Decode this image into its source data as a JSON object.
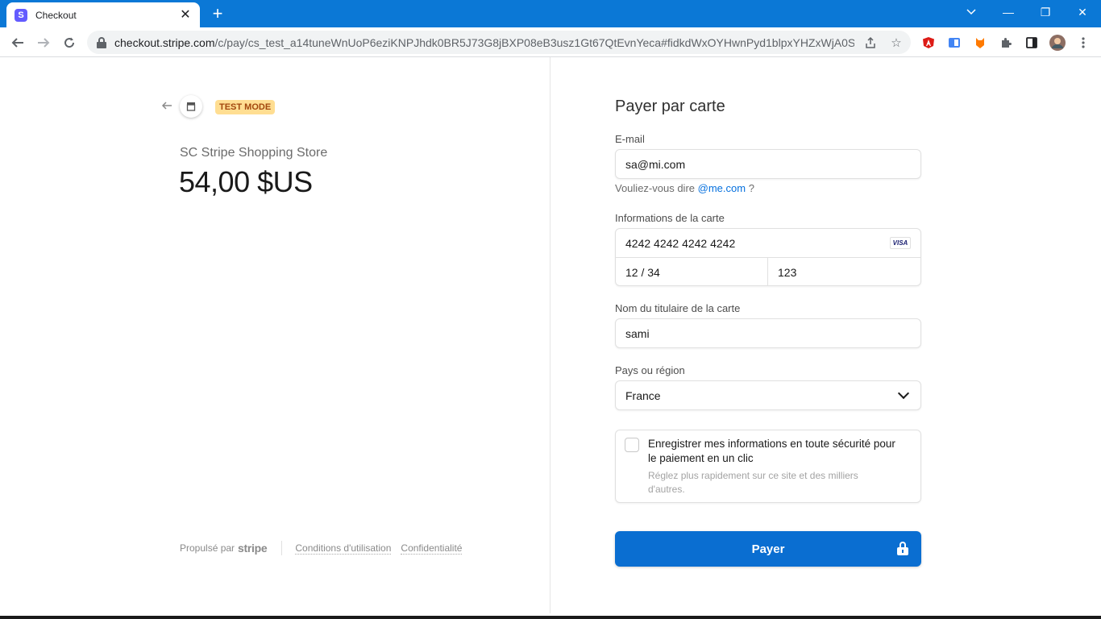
{
  "browser": {
    "tab_title": "Checkout",
    "tab_favicon": "S",
    "url_host": "checkout.stripe.com",
    "url_path": "/c/pay/cs_test_a14tuneWnUoP6eziKNPJhdk0BR5J73G8jBXP08eB3usz1Gt67QtEvnYeca#fidkdWxOYHwnPyd1blpxYHZxWjA0SXVG...",
    "win_minimize": "—",
    "win_restore": "❐",
    "win_close": "✕"
  },
  "merchant": {
    "test_mode_label": "TEST MODE",
    "store_name": "SC Stripe Shopping Store",
    "amount": "54,00 $US"
  },
  "footer": {
    "powered_by": "Propulsé par",
    "brand": "stripe",
    "terms": "Conditions d'utilisation",
    "privacy": "Confidentialité"
  },
  "form": {
    "title": "Payer par carte",
    "email_label": "E-mail",
    "email_value": "sa@mi.com",
    "email_hint_prefix": "Vouliez-vous dire",
    "email_hint_suggestion": "@me.com",
    "email_hint_suffix": "?",
    "card_label": "Informations de la carte",
    "card_number": "4242 4242 4242 4242",
    "card_brand": "VISA",
    "card_expiry": "12 / 34",
    "card_cvc": "123",
    "name_label": "Nom du titulaire de la carte",
    "name_value": "sami",
    "country_label": "Pays ou région",
    "country_value": "France",
    "save_title": "Enregistrer mes informations en toute sécurité pour le paiement en un clic",
    "save_subtitle": "Réglez plus rapidement sur ce site et des milliers d'autres.",
    "pay_label": "Payer"
  },
  "colors": {
    "titlebar": "#0b78d6",
    "pay_button": "#0a6ed1",
    "test_badge_bg": "#ffde92",
    "test_badge_text": "#a2470d",
    "link": "#0570de"
  }
}
